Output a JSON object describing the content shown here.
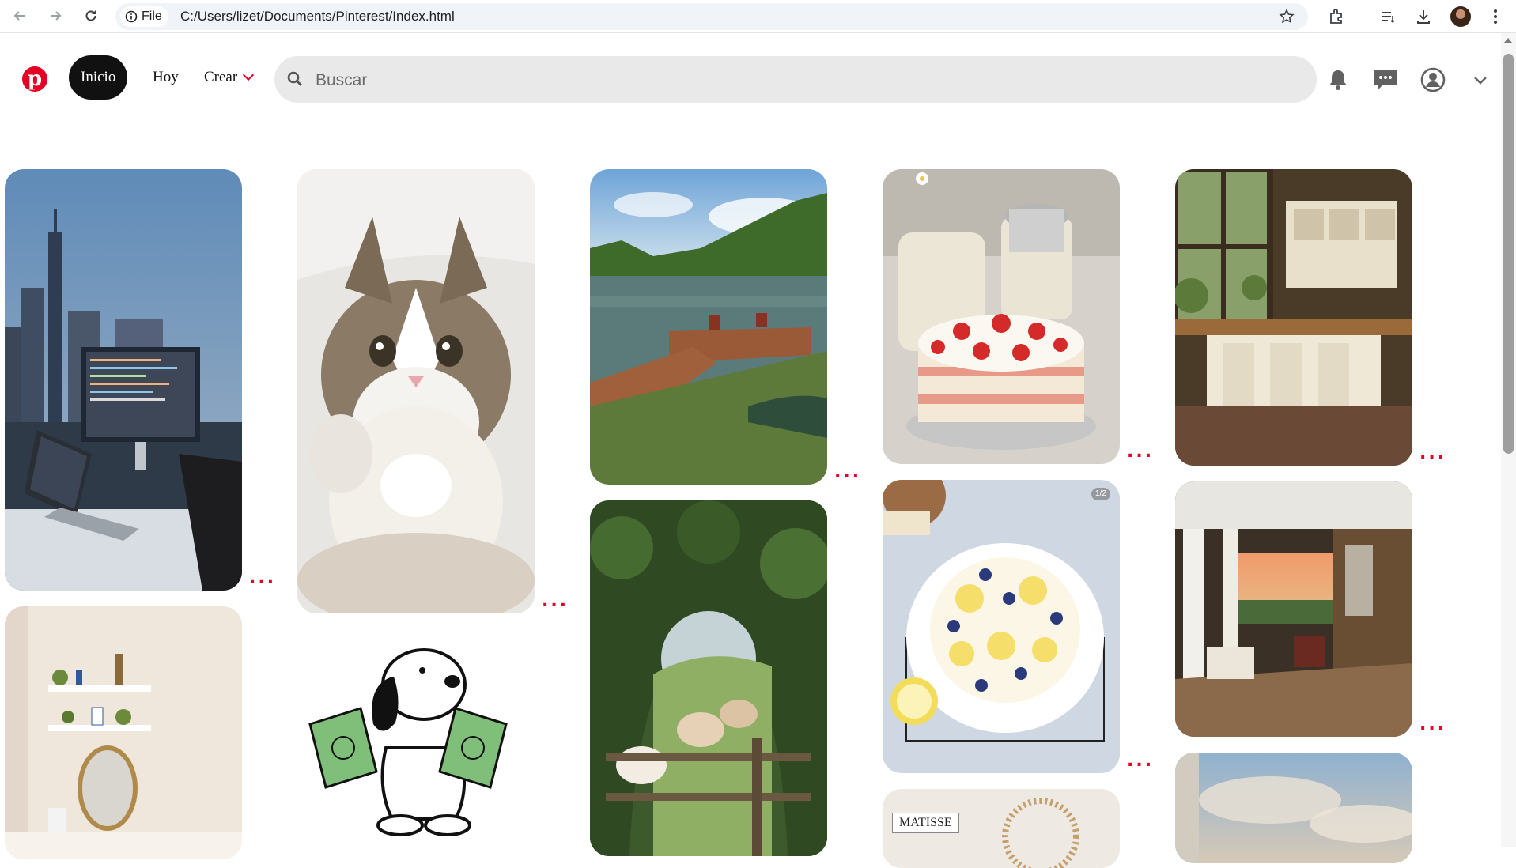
{
  "browser": {
    "file_label": "File",
    "url": "C:/Users/lizet/Documents/Pinterest/Index.html"
  },
  "header": {
    "logo_letter": "p",
    "nav": {
      "home": "Inicio",
      "today": "Hoy",
      "create": "Crear"
    },
    "search": {
      "placeholder": "Buscar",
      "value": ""
    }
  },
  "pins": {
    "more_label": "...",
    "cake_badge": "1/2",
    "poster_text": "MATISSE"
  }
}
